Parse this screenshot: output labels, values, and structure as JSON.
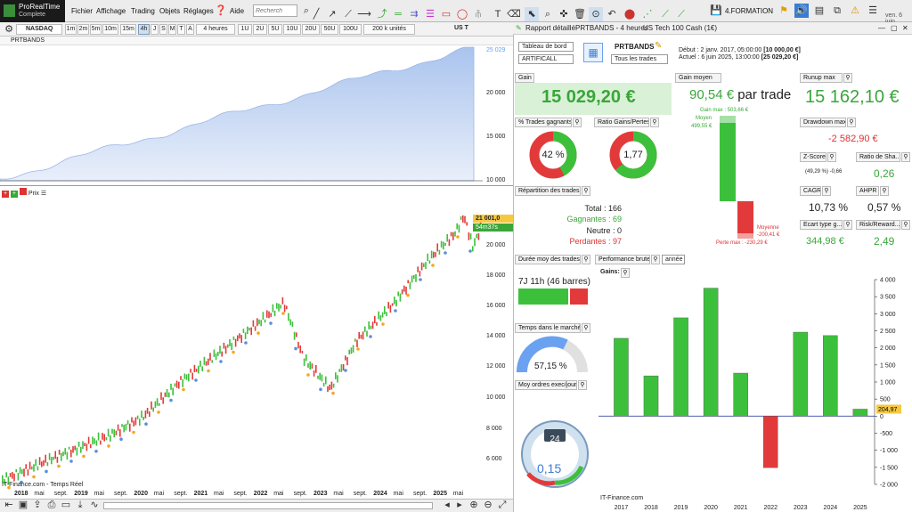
{
  "app": {
    "name": "ProRealTime",
    "edition": "Complete"
  },
  "menu": [
    "Fichier",
    "Affichage",
    "Trading",
    "Objets",
    "Réglages",
    "Aide"
  ],
  "search_placeholder": "Recherch",
  "toolbar_right": {
    "formation": "4.FORMATION",
    "datetime": "ven. 6 juin"
  },
  "chart": {
    "symbol": "NASDAQ",
    "timeframes": [
      "1m",
      "2m",
      "5m",
      "10m",
      "15m",
      "4h",
      "J",
      "S",
      "M",
      "T",
      "A"
    ],
    "active_timeframe": "4h",
    "period": "4 heures",
    "ticks": [
      "1U",
      "2U",
      "5U",
      "10U",
      "20U",
      "50U",
      "100U"
    ],
    "units": "200 k unités",
    "instrument": "US T",
    "equity_label": "PRTBANDS",
    "price_label": "Prix",
    "price_tag": "21 001,0",
    "countdown": "54m37s",
    "equity_top": "25 029",
    "equity_ticks": [
      "20 000",
      "15 000",
      "10 000"
    ],
    "price_ticks": [
      "20 000",
      "18 000",
      "16 000",
      "14 000",
      "12 000",
      "10 000",
      "8 000",
      "6 000"
    ],
    "x_labels": [
      "2018",
      "mai",
      "sept.",
      "2019",
      "mai",
      "sept.",
      "2020",
      "mai",
      "sept.",
      "2021",
      "mai",
      "sept.",
      "2022",
      "mai",
      "sept.",
      "2023",
      "mai",
      "sept.",
      "2024",
      "mai",
      "sept.",
      "2025",
      "mai"
    ],
    "footer": "IT-Finance.com - Temps Réel"
  },
  "report": {
    "title": "Rapport détaillé",
    "system": "PRTBANDS - 4 heures",
    "instrument": "US Tech 100 Cash (1€)",
    "dashboard": "Tableau de bord",
    "strategy": "ARTIFICALL",
    "name": "PRTBANDS",
    "trades_filter": "Tous les trades",
    "debut_label": "Début :",
    "debut": "2 janv. 2017, 05:00:00",
    "debut_val": "[10 000,00 €]",
    "actuel_label": "Actuel :",
    "actuel": "6 juin 2025, 13:00:00",
    "actuel_val": "[25 029,20 €]",
    "gain_label": "Gain",
    "gain": "15 029,20 €",
    "avg_label": "Gain moyen",
    "avg": "90,54 €",
    "avg_suffix": "par trade",
    "runup_label": "Runup max",
    "runup": "15 162,10 €",
    "gain_max": "Gain max : 503,66 €",
    "moyen": "Moyen",
    "moyen_val": "499,55 €",
    "moyenne": "Moyenne",
    "moyenne_val": "-200,41 €",
    "perte_max": "Perte max : -230,29 €",
    "pct_label": "% Trades gagnants",
    "pct": "42 %",
    "ratio_label": "Ratio Gains/Pertes",
    "ratio": "1,77",
    "dd_label": "Drawdown max",
    "dd": "-2 582,90 €",
    "z_label": "Z-Score",
    "z_info": "(49,29 %)  -0,66",
    "sharpe_label": "Ratio de Sha...",
    "sharpe": "0,26",
    "cagr_label": "CAGR",
    "cagr": "10,73 %",
    "ahpr_label": "AHPR",
    "ahpr": "0,57 %",
    "ecart_label": "Ecart type g...",
    "ecart": "344,98 €",
    "risk_label": "Risk/Reward...",
    "risk": "2,49",
    "rep_label": "Répartition des trades",
    "total": "Total : 166",
    "gagnantes": "Gagnantes : 69",
    "neutre": "Neutre : 0",
    "perdantes": "Perdantes : 97",
    "duree_label": "Durée moy des trades",
    "duree": "7J 11h (46 barres)",
    "temps_label": "Temps dans le marché",
    "temps": "57,15 %",
    "moy_label": "Moy ordres exec/jour",
    "moy_gauge": "24",
    "moy": "0,15",
    "perf_label": "Performance brute",
    "perf_period": "année",
    "gains_label": "Gains:",
    "footer": "IT-Finance.com",
    "last_tag": "204,97"
  },
  "colors": {
    "green": "#3cc03c",
    "red": "#e23a3a",
    "accent": "#6aa1f0"
  },
  "chart_data": {
    "type": "bar",
    "categories": [
      "2017",
      "2018",
      "2019",
      "2020",
      "2021",
      "2022",
      "2023",
      "2024",
      "2025"
    ],
    "values": [
      2280,
      1180,
      2880,
      3750,
      1260,
      -1510,
      2460,
      2360,
      205
    ],
    "ylim": [
      -2000,
      4000
    ],
    "yticks": [
      "4 000",
      "3 500",
      "3 000",
      "2 500",
      "2 000",
      "1 500",
      "1 000",
      "500",
      "0",
      "-500",
      "-1 000",
      "-1 500",
      "-2 000"
    ]
  }
}
